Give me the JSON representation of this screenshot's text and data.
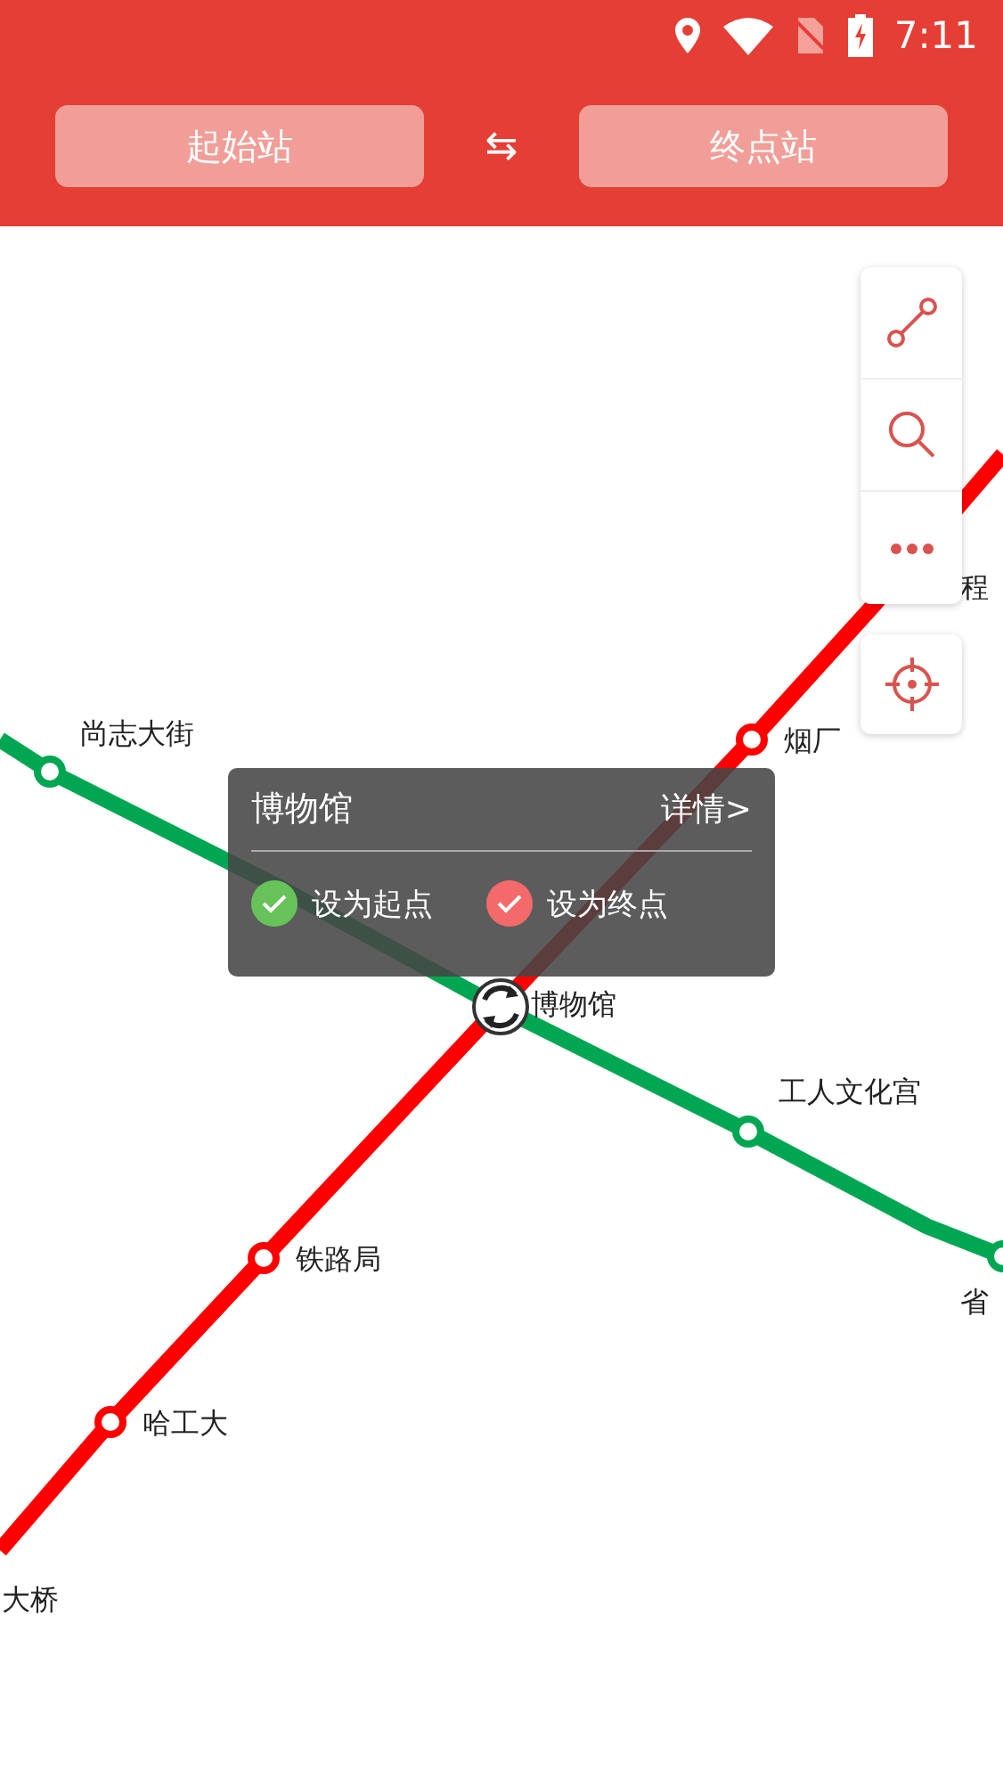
{
  "status_bar": {
    "time": "7:11"
  },
  "header": {
    "start_button": "起始站",
    "end_button": "终点站",
    "swap": "⇆"
  },
  "lines": [
    {
      "color": "#ff0000",
      "stations": [
        {
          "name": "大桥"
        },
        {
          "name": "哈工大"
        },
        {
          "name": "铁路局"
        },
        {
          "name": "烟厂"
        },
        {
          "name": "程"
        }
      ]
    },
    {
      "color": "#00a651",
      "stations": [
        {
          "name": "尚志大街"
        },
        {
          "name": "工人文化宫"
        },
        {
          "name": "省"
        }
      ]
    }
  ],
  "transfer_station": {
    "name": "博物馆"
  },
  "popup": {
    "title": "博物馆",
    "details_link": "详情>",
    "set_start": "设为起点",
    "set_end": "设为终点"
  }
}
